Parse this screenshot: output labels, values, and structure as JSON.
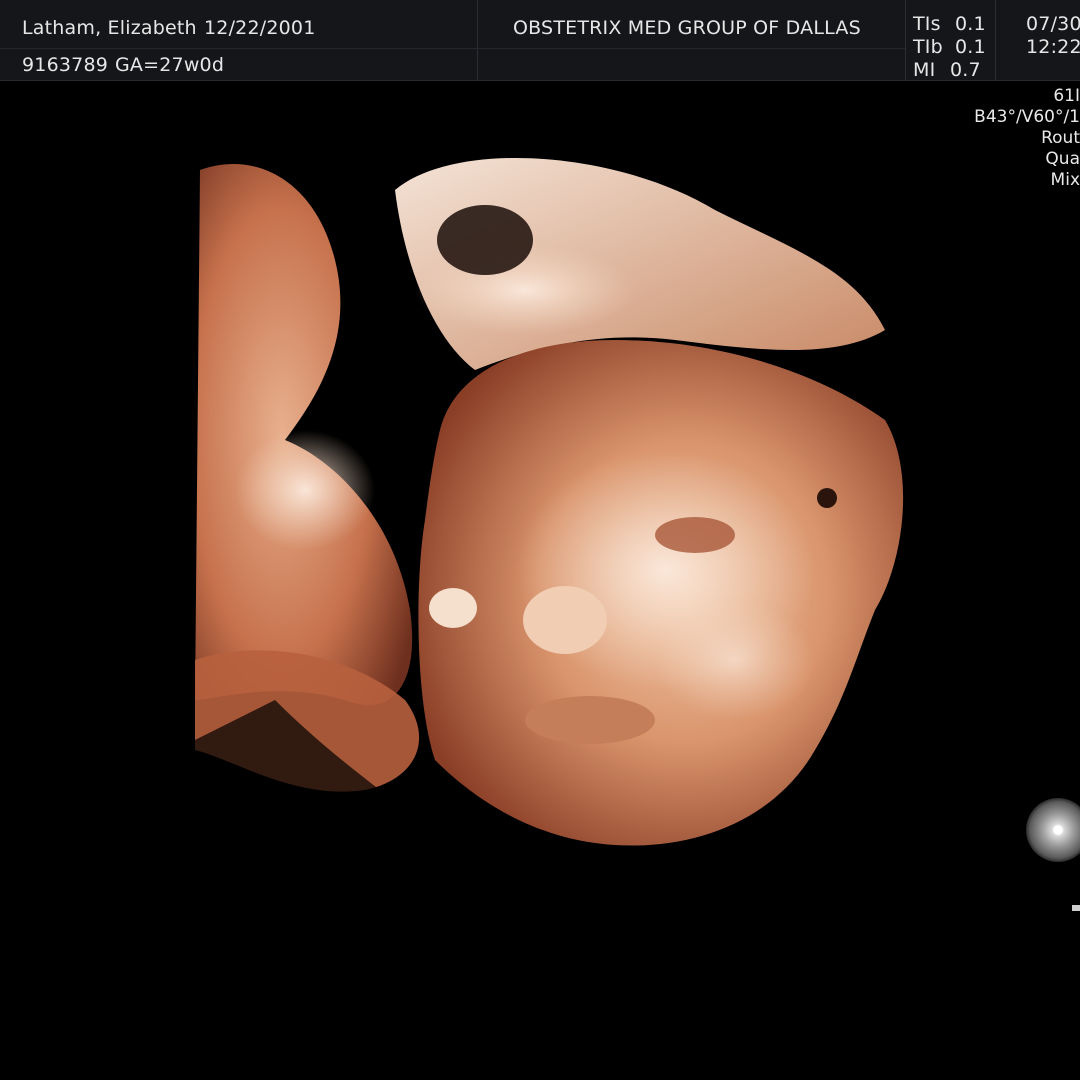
{
  "header": {
    "patient_name": "Latham, Elizabeth",
    "birth_date": "12/22/2001",
    "patient_id": "9163789",
    "gestational_age": "GA=27w0d",
    "institution": "OBSTETRIX MED GROUP OF DALLAS",
    "tis_label": "TIs",
    "tis_value": "0.1",
    "tib_label": "TIb",
    "tib_value": "0.1",
    "mi_label": "MI",
    "mi_value": "0.7",
    "date": "07/30",
    "time": "12:22:"
  },
  "acquisition": {
    "lines": [
      "61I",
      "B43°/V60°/1",
      "Rout",
      "Qua",
      "Mix"
    ]
  },
  "colors": {
    "background": "#000000",
    "header_bg": "#15161a",
    "render_tone_light": "#f3d6bf",
    "render_tone_mid": "#d88a62",
    "render_tone_dark": "#6e2f1e"
  }
}
